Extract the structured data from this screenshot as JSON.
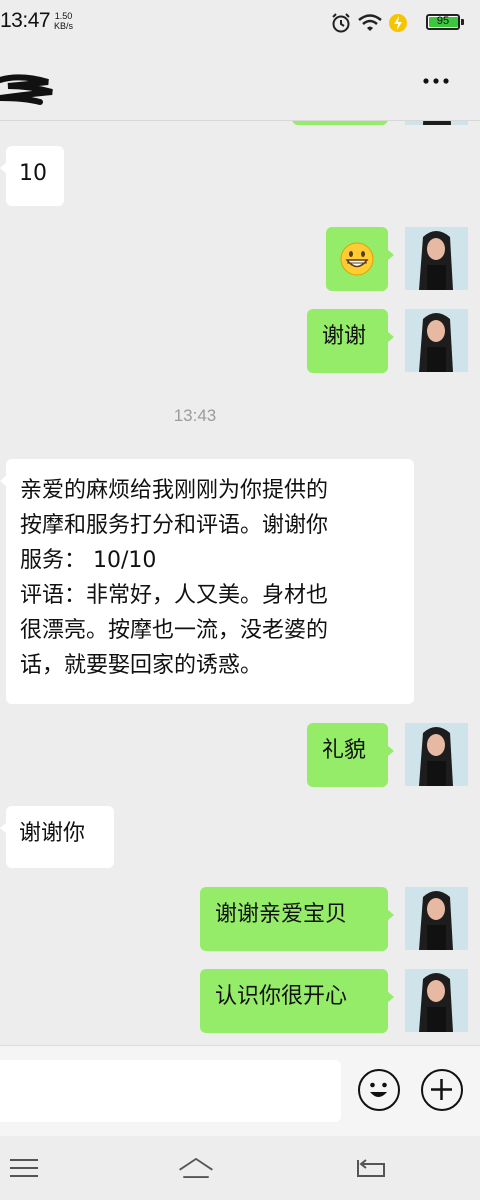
{
  "status_bar": {
    "time": "13:47",
    "net_speed_value": "1.50",
    "net_speed_unit": "KB/s",
    "battery_level": "95",
    "icons": [
      "alarm-icon",
      "wifi-icon",
      "charging-icon",
      "battery-icon"
    ]
  },
  "header": {
    "contact_name": "(redacted)",
    "more_icon": "more-dots-icon"
  },
  "messages": [
    {
      "type": "text",
      "side": "in",
      "text": "10"
    },
    {
      "type": "emoji",
      "side": "out",
      "emoji": "grinning-face"
    },
    {
      "type": "text",
      "side": "out",
      "text": "谢谢"
    },
    {
      "type": "time",
      "text": "13:43"
    },
    {
      "type": "text",
      "side": "in",
      "text": "亲爱的麻烦给我刚刚为你提供的\n按摩和服务打分和评语。谢谢你\n服务： 10/10\n评语：非常好，人又美。身材也\n很漂亮。按摩也一流，没老婆的\n话，就要娶回家的诱惑。"
    },
    {
      "type": "text",
      "side": "out",
      "text": "礼貌"
    },
    {
      "type": "text",
      "side": "in",
      "text": "谢谢你"
    },
    {
      "type": "text",
      "side": "out",
      "text": "谢谢亲爱宝贝"
    },
    {
      "type": "text",
      "side": "out",
      "text": "认识你很开心"
    }
  ],
  "input_bar": {
    "placeholder": "",
    "emoji_button_icon": "emoji-icon",
    "plus_button_icon": "plus-icon"
  },
  "nav_bar": {
    "icons": [
      "menu-icon",
      "home-icon",
      "back-icon"
    ]
  },
  "colors": {
    "background": "#ededed",
    "bubble_out": "#95ec69",
    "bubble_in": "#ffffff",
    "battery_fill": "#3cc73c"
  }
}
